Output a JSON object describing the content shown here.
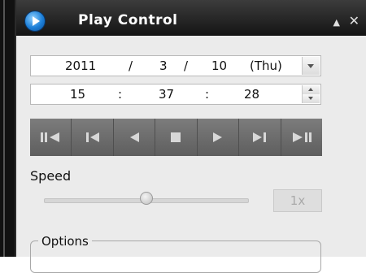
{
  "window": {
    "title": "Play Control",
    "collapse_glyph": "▲",
    "close_glyph": "✕"
  },
  "date": {
    "year": "2011",
    "sep1": "/",
    "month": "3",
    "sep2": "/",
    "day": "10",
    "weekday": "(Thu)"
  },
  "time": {
    "hour": "15",
    "sep1": ":",
    "minute": "37",
    "sep2": ":",
    "second": "28"
  },
  "controls": [
    {
      "name": "step-back-pause",
      "icon": "frame-step-back-icon"
    },
    {
      "name": "skip-to-start",
      "icon": "skip-back-icon"
    },
    {
      "name": "play-reverse",
      "icon": "play-reverse-icon"
    },
    {
      "name": "stop",
      "icon": "stop-icon"
    },
    {
      "name": "play",
      "icon": "play-icon"
    },
    {
      "name": "skip-to-end",
      "icon": "skip-forward-icon"
    },
    {
      "name": "step-forward-pause",
      "icon": "frame-step-forward-icon"
    }
  ],
  "speed": {
    "label": "Speed",
    "value": "1x",
    "slider_position": 0.5
  },
  "options": {
    "label": "Options"
  },
  "colors": {
    "titlebar": "#1e1e1e",
    "panel": "#ebebeb",
    "controls": "#6b6b6b",
    "accent": "#1c7fd8"
  }
}
